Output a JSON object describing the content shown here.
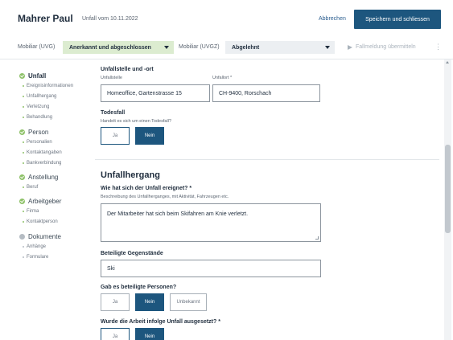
{
  "header": {
    "title": "Mahrer Paul",
    "subtitle": "Unfall vom 10.11.2022",
    "cancel_label": "Abbrechen",
    "save_label": "Speichern und schliessen"
  },
  "statusbar": {
    "uvg_label": "Mobiliar (UVG)",
    "uvg_value": "Anerkannt und abgeschlossen",
    "uvgz_label": "Mobiliar (UVGZ)",
    "uvgz_value": "Abgelehnt",
    "send_label": "Fallmeldung übermitteln",
    "more_label": "⋮"
  },
  "sidebar": {
    "sections": [
      {
        "label": "Unfall",
        "status": "done",
        "items": [
          "Ereignisinformationen",
          "Unfallhergang",
          "Verletzung",
          "Behandlung"
        ]
      },
      {
        "label": "Person",
        "status": "done",
        "items": [
          "Personalien",
          "Kontaktangaben",
          "Bankverbindung"
        ]
      },
      {
        "label": "Anstellung",
        "status": "done",
        "items": [
          "Beruf"
        ]
      },
      {
        "label": "Arbeitgeber",
        "status": "done",
        "items": [
          "Firma",
          "Kontaktperson"
        ]
      },
      {
        "label": "Dokumente",
        "status": "pending",
        "items": [
          "Anhänge",
          "Formulare"
        ]
      }
    ]
  },
  "content": {
    "location": {
      "heading": "Unfallstelle und -ort",
      "place_label": "Unfallstelle",
      "place_value": "Homeoffice, Gartenstrasse 15",
      "city_label": "Unfallort *",
      "city_value": "CH-9400, Rorschach"
    },
    "death": {
      "heading": "Todesfall",
      "question": "Handelt es sich um einen Todesfall?",
      "options": [
        "Ja",
        "Nein"
      ],
      "selected": "Nein"
    },
    "hergang": {
      "heading": "Unfallhergang",
      "question": "Wie hat sich der Unfall ereignet? *",
      "hint": "Beschreibung des Unfallherganges, mit Aktivität, Fahrzeugen etc.",
      "value": "Der Mitarbeiter hat sich beim Skifahren am Knie verletzt."
    },
    "objects": {
      "heading": "Beteiligte Gegenstände",
      "value": "Ski"
    },
    "persons": {
      "heading": "Gab es beteiligte Personen?",
      "options": [
        "Ja",
        "Nein",
        "Unbekannt"
      ],
      "selected": "Nein"
    },
    "work": {
      "heading": "Wurde die Arbeit infolge Unfall ausgesetzt? *",
      "options": [
        "Ja",
        "Nein"
      ],
      "selected": "Nein"
    }
  },
  "colors": {
    "primary": "#1d567e",
    "success": "#8fc26a",
    "status_green_bg": "#dcecd0"
  }
}
